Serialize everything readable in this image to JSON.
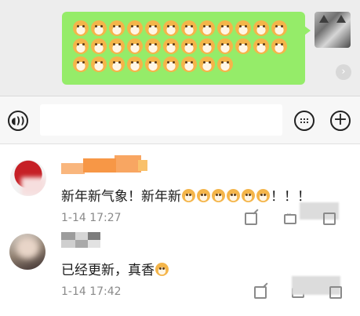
{
  "chat": {
    "emoji_count": 33,
    "emoji_icon": "doge-emoji",
    "status_icon": "chevron-right-icon",
    "status_glyph": "›"
  },
  "input_bar": {
    "placeholder": "",
    "voice_glyph": "◖))",
    "plus_glyph": "+"
  },
  "comments": [
    {
      "text": "新年新气象！新年新",
      "emoji_count": 6,
      "suffix": "！！！",
      "time": "1-14 17:27"
    },
    {
      "text": "已经更新，真香",
      "emoji_count": 1,
      "suffix": "",
      "time": "1-14 17:42"
    }
  ],
  "colors": {
    "bubble": "#95ec69",
    "chat_bg": "#ededed",
    "name_mosaic": "#f79746"
  }
}
